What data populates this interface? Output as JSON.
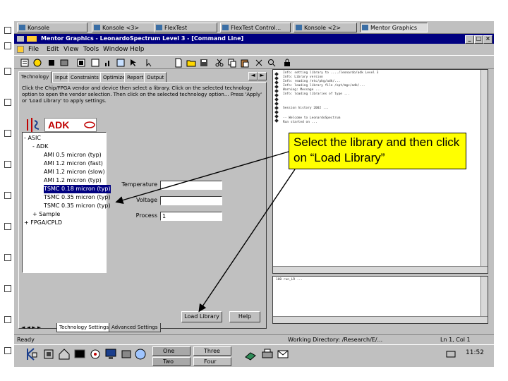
{
  "taskbar_top": {
    "tasks": [
      {
        "label": "Konsole"
      },
      {
        "label": "Konsole <3>"
      },
      {
        "label": "FlexTest"
      },
      {
        "label": "FlexTest Control..."
      },
      {
        "label": "Konsole <2>"
      },
      {
        "label": "Mentor Graphics"
      }
    ]
  },
  "window": {
    "title": "Mentor Graphics - LeonardoSpectrum Level 3 - [Command Line]",
    "menus": [
      "File",
      "Edit",
      "View",
      "Tools",
      "Window",
      "Help"
    ]
  },
  "tabs": [
    "Technology",
    "Input",
    "Constraints",
    "Optimize",
    "Report",
    "Output"
  ],
  "description": "Click the Chip/FPGA vendor and device then select a library. Click on the selected technology option to open the vendor selection. Then click on the selected technology option... Press 'Apply' or 'Load Library' to apply settings.",
  "logo": {
    "text": "ADK"
  },
  "tree": {
    "items": [
      {
        "label": "ASIC",
        "indent": 0,
        "expander": "-"
      },
      {
        "label": "ADK",
        "indent": 1,
        "expander": "-"
      },
      {
        "label": "AMI 0.5 micron (typ)",
        "indent": 2,
        "expander": ""
      },
      {
        "label": "AMI 1.2 micron (fast)",
        "indent": 2,
        "expander": ""
      },
      {
        "label": "AMI 1.2 micron (slow)",
        "indent": 2,
        "expander": ""
      },
      {
        "label": "AMI 1.2 micron (typ)",
        "indent": 2,
        "expander": ""
      },
      {
        "label": "TSMC 0.18 micron (typ)",
        "indent": 2,
        "expander": "",
        "selected": true
      },
      {
        "label": "TSMC 0.35 micron (typ)",
        "indent": 2,
        "expander": ""
      },
      {
        "label": "TSMC 0.35 micron (typ)",
        "indent": 2,
        "expander": ""
      },
      {
        "label": "Sample",
        "indent": 1,
        "expander": "+"
      },
      {
        "label": "FPGA/CPLD",
        "indent": 0,
        "expander": "+"
      }
    ]
  },
  "fields": {
    "temperature": {
      "label": "Temperature",
      "value": ""
    },
    "voltage": {
      "label": "Voltage",
      "value": ""
    },
    "process": {
      "label": "Process",
      "value": "1"
    }
  },
  "buttons": {
    "load_library": "Load Library",
    "help": "Help"
  },
  "bottom_tabs": [
    "Technology Settings",
    "Advanced Settings"
  ],
  "log": {
    "lines": [
      "Info: setting library to ..../leonardo/adk Level 3",
      "Info: Library version",
      "Info: reading /etc/pkg/adk/...",
      "Info: loading library file /opt/mgc/adk/...",
      "Warning: Message ...",
      "Info: loading libraries of type ...",
      "",
      "Session history 2002 ...",
      "",
      "-- Welcome to LeonardoSpectrum",
      "   Run started on ..."
    ]
  },
  "cmd": {
    "line": "100 run_LR ..."
  },
  "status": {
    "left": "Ready",
    "middle": "Working Directory: /Research/E/...",
    "right": "Ln 1, Col 1"
  },
  "taskbar_bot": {
    "quick": [
      {
        "label": "One"
      },
      {
        "label": "Two"
      },
      {
        "label": "Three"
      },
      {
        "label": "Four"
      }
    ],
    "clock": "11:52"
  },
  "callout": {
    "text": "Select the library and then click on “Load Library”"
  },
  "colors": {
    "titlebar": "#000080",
    "callout": "#ffff00",
    "selection": "#000080"
  }
}
